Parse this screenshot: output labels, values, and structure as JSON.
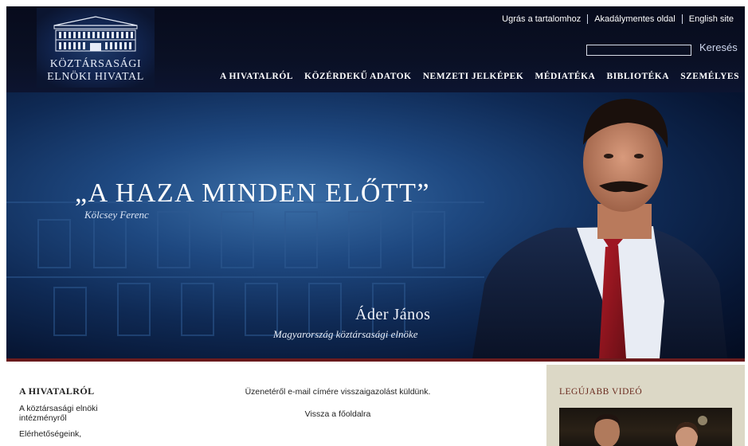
{
  "header": {
    "logo": {
      "line1": "KÖZTÁRSASÁGI",
      "line2": "ELNÖKI HIVATAL"
    },
    "utility_links": [
      "Ugrás a tartalomhoz",
      "Akadálymentes oldal",
      "English site"
    ],
    "search": {
      "button_label": "Keresés",
      "value": ""
    },
    "main_nav": [
      "A HIVATALRÓL",
      "KÖZÉRDEKŰ ADATOK",
      "NEMZETI JELKÉPEK",
      "MÉDIATÉKA",
      "BIBLIOTÉKA",
      "SZEMÉLYES"
    ]
  },
  "hero": {
    "quote": "„A HAZA MINDEN ELŐTT”",
    "quote_author": "Kölcsey Ferenc",
    "name": "Áder János",
    "title": "Magyarország köztársasági elnöke"
  },
  "sidebar_left": {
    "heading": "A HIVATALRÓL",
    "links": [
      "A köztársasági elnöki intézményről",
      "Elérhetőségeink,"
    ]
  },
  "main": {
    "message": "Üzenetéről e-mail címére visszaigazolást küldünk.",
    "back_link": "Vissza a főoldalra"
  },
  "sidebar_right": {
    "heading": "LEGÚJABB VIDEÓ"
  },
  "colors": {
    "header_bg": "#0a1024",
    "accent_maroon": "#6a1a1c",
    "right_panel_bg": "#dcd8c6"
  }
}
